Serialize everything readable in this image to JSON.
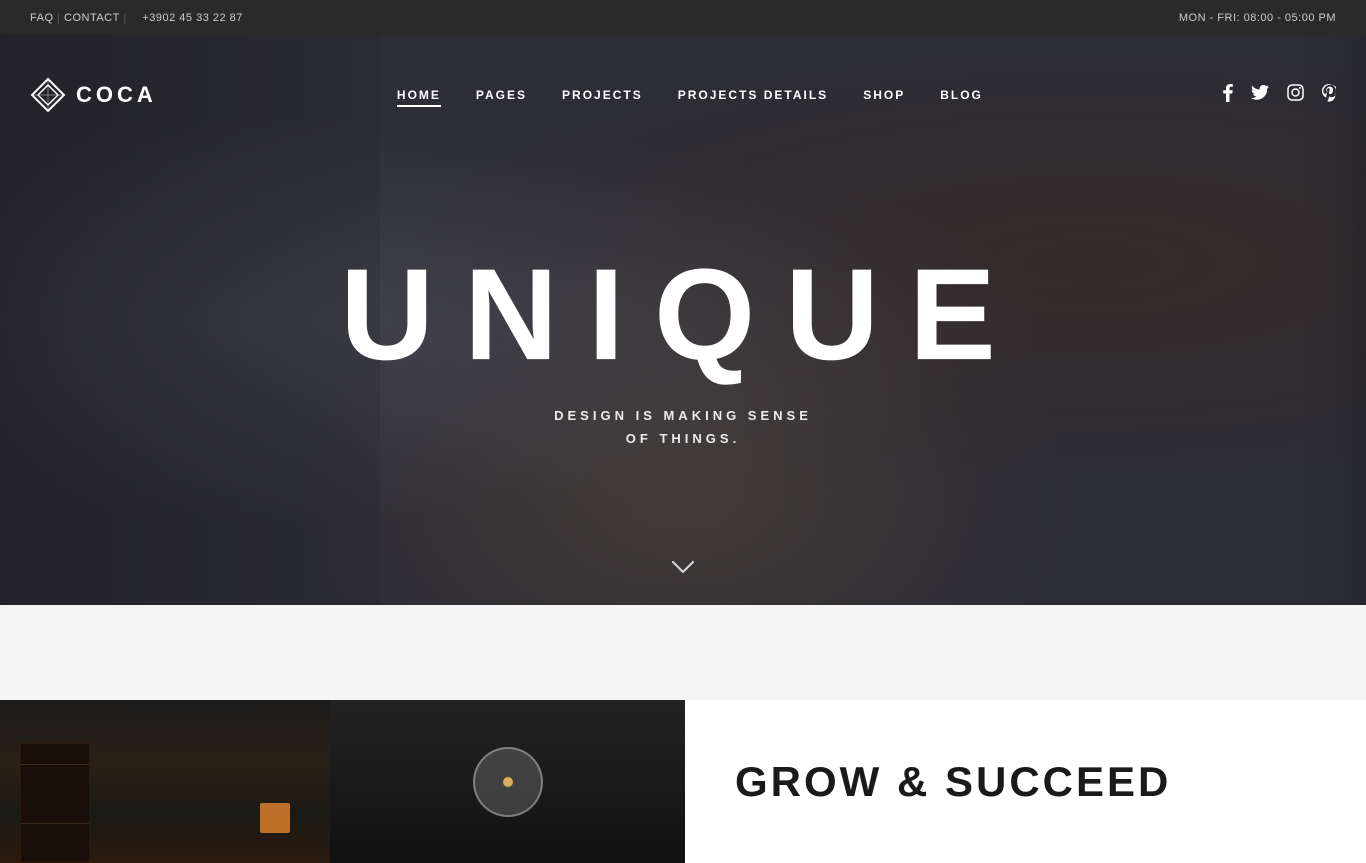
{
  "topbar": {
    "faq": "FAQ",
    "contact": "CONTACT",
    "phone": "+3902 45 33 22 87",
    "hours": "MON - FRI: 08:00 - 05:00 PM",
    "separator": "|"
  },
  "logo": {
    "text": "COCA"
  },
  "nav": {
    "items": [
      {
        "label": "HOME",
        "active": true
      },
      {
        "label": "PAGES",
        "active": false
      },
      {
        "label": "PROJECTS",
        "active": false
      },
      {
        "label": "PROJECTS DETAILS",
        "active": false
      },
      {
        "label": "SHOP",
        "active": false
      },
      {
        "label": "BLOG",
        "active": false
      }
    ]
  },
  "social": {
    "facebook": "f",
    "twitter": "𝕏",
    "instagram": "⊡",
    "pinterest": "𝒫"
  },
  "hero": {
    "title": "UNIQUE",
    "subtitle_line1": "DESIGN IS MAKING SENSE",
    "subtitle_line2": "OF THINGS.",
    "scroll_arrow": "∨"
  },
  "bottom": {
    "grow_title": "GROW & SUCCEED"
  }
}
